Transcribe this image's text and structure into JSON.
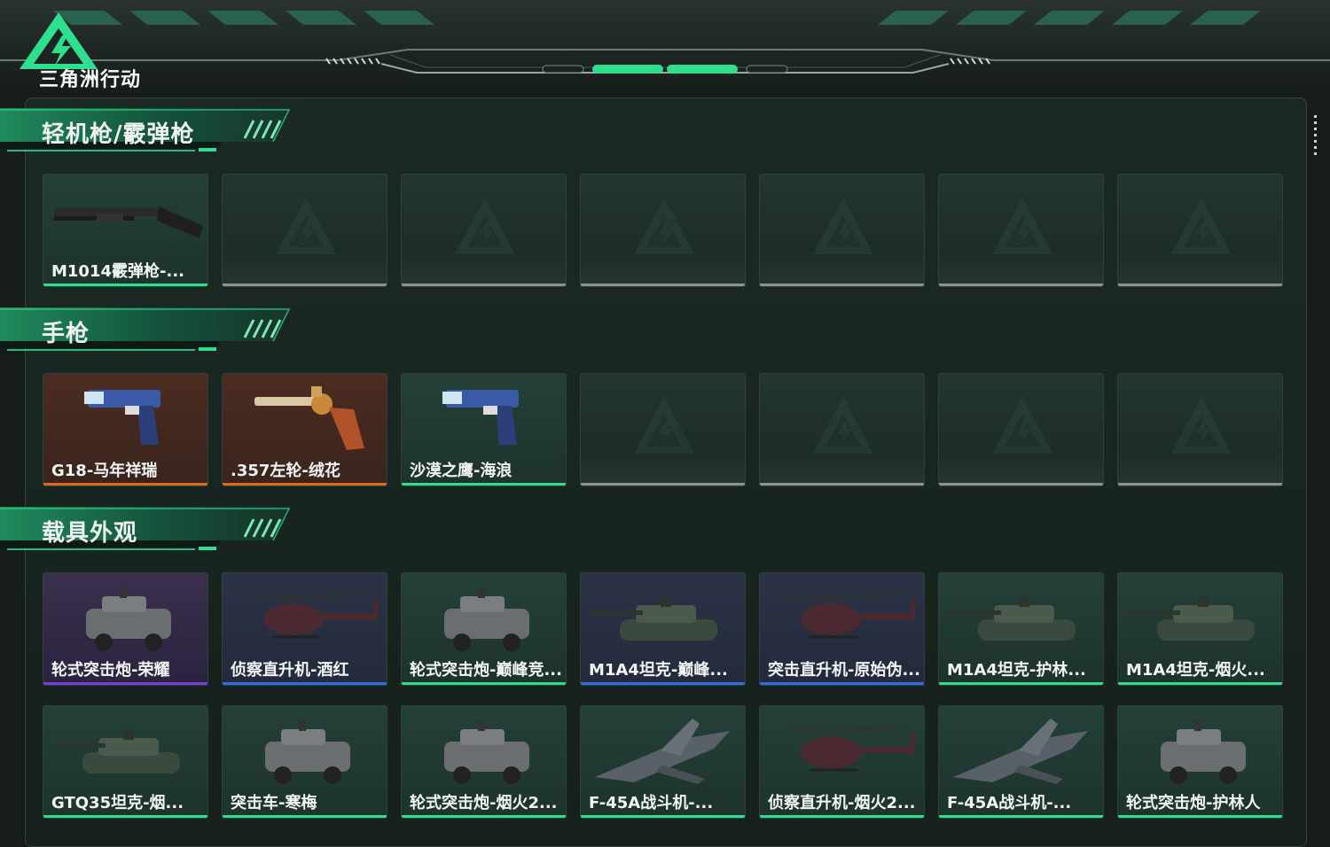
{
  "app": {
    "logo_text": "三角洲行动"
  },
  "colors": {
    "accent_green": "#2ee08e",
    "rarity_orange": "#e06a1c",
    "rarity_purple": "#7a3fd8",
    "rarity_blue": "#2f6de0",
    "rarity_gray": "#8c9490"
  },
  "sections": [
    {
      "title": "轻机枪/霰弹枪",
      "items": [
        {
          "label": "M1014霰弹枪-...",
          "rarity": "green",
          "icon": "shotgun-icon"
        },
        {
          "label": "",
          "rarity": "empty",
          "icon": "placeholder-logo-icon"
        },
        {
          "label": "",
          "rarity": "empty",
          "icon": "placeholder-logo-icon"
        },
        {
          "label": "",
          "rarity": "empty",
          "icon": "placeholder-logo-icon"
        },
        {
          "label": "",
          "rarity": "empty",
          "icon": "placeholder-logo-icon"
        },
        {
          "label": "",
          "rarity": "empty",
          "icon": "placeholder-logo-icon"
        },
        {
          "label": "",
          "rarity": "empty",
          "icon": "placeholder-logo-icon"
        }
      ]
    },
    {
      "title": "手枪",
      "items": [
        {
          "label": "G18-马年祥瑞",
          "rarity": "orange",
          "icon": "pistol-icon"
        },
        {
          "label": ".357左轮-绒花",
          "rarity": "orange",
          "icon": "revolver-icon"
        },
        {
          "label": "沙漠之鹰-海浪",
          "rarity": "green",
          "icon": "pistol-icon"
        },
        {
          "label": "",
          "rarity": "empty",
          "icon": "placeholder-logo-icon"
        },
        {
          "label": "",
          "rarity": "empty",
          "icon": "placeholder-logo-icon"
        },
        {
          "label": "",
          "rarity": "empty",
          "icon": "placeholder-logo-icon"
        },
        {
          "label": "",
          "rarity": "empty",
          "icon": "placeholder-logo-icon"
        }
      ]
    },
    {
      "title": "载具外观",
      "items": [
        {
          "label": "轮式突击炮-荣耀",
          "rarity": "purple",
          "icon": "armored-car-icon"
        },
        {
          "label": "侦察直升机-酒红",
          "rarity": "blue",
          "icon": "helicopter-icon"
        },
        {
          "label": "轮式突击炮-巅峰竞...",
          "rarity": "green",
          "icon": "armored-car-icon"
        },
        {
          "label": "M1A4坦克-巅峰...",
          "rarity": "blue",
          "icon": "tank-icon"
        },
        {
          "label": "突击直升机-原始伪...",
          "rarity": "blue",
          "icon": "helicopter-icon"
        },
        {
          "label": "M1A4坦克-护林...",
          "rarity": "green",
          "icon": "tank-icon"
        },
        {
          "label": "M1A4坦克-烟火...",
          "rarity": "green",
          "icon": "tank-icon"
        },
        {
          "label": "GTQ35坦克-烟...",
          "rarity": "green",
          "icon": "tank-icon"
        },
        {
          "label": "突击车-寒梅",
          "rarity": "green",
          "icon": "armored-car-icon"
        },
        {
          "label": "轮式突击炮-烟火2...",
          "rarity": "green",
          "icon": "armored-car-icon"
        },
        {
          "label": "F-45A战斗机-...",
          "rarity": "green",
          "icon": "fighter-jet-icon"
        },
        {
          "label": "侦察直升机-烟火2...",
          "rarity": "green",
          "icon": "helicopter-icon"
        },
        {
          "label": "F-45A战斗机-...",
          "rarity": "green",
          "icon": "fighter-jet-icon"
        },
        {
          "label": "轮式突击炮-护林人",
          "rarity": "green",
          "icon": "armored-car-icon"
        }
      ]
    }
  ]
}
